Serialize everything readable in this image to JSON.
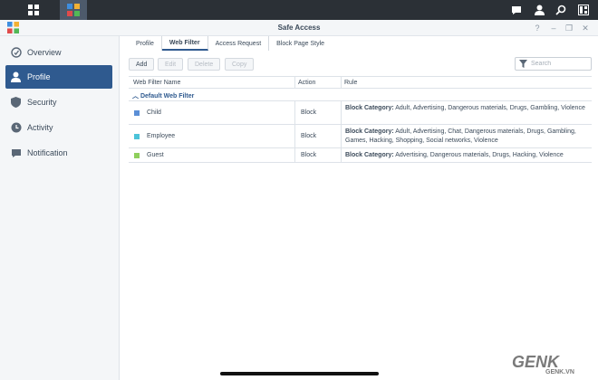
{
  "window": {
    "title": "Safe Access"
  },
  "sidebar": {
    "items": [
      {
        "label": "Overview",
        "icon": "overview-icon"
      },
      {
        "label": "Profile",
        "icon": "profile-icon",
        "active": true
      },
      {
        "label": "Security",
        "icon": "shield-icon"
      },
      {
        "label": "Activity",
        "icon": "activity-icon"
      },
      {
        "label": "Notification",
        "icon": "notification-icon"
      }
    ]
  },
  "tabs": [
    {
      "label": "Profile"
    },
    {
      "label": "Web Filter",
      "active": true
    },
    {
      "label": "Access Request"
    },
    {
      "label": "Block Page Style"
    }
  ],
  "toolbar": {
    "add": "Add",
    "edit": "Edit",
    "delete": "Delete",
    "copy": "Copy",
    "search_placeholder": "Search"
  },
  "grid": {
    "columns": {
      "name": "Web Filter Name",
      "action": "Action",
      "rule": "Rule"
    },
    "group": "Default Web Filter",
    "rows": [
      {
        "name": "Child",
        "color": "#5b8fd6",
        "action": "Block",
        "rule_label": "Block Category:",
        "rule_text": "Adult, Advertising, Dangerous materials, Drugs, Gambling, Violence"
      },
      {
        "name": "Employee",
        "color": "#4cc3d9",
        "action": "Block",
        "rule_label": "Block Category:",
        "rule_text": "Adult, Advertising, Chat, Dangerous materials, Drugs, Gambling, Games, Hacking, Shopping, Social networks, Violence"
      },
      {
        "name": "Guest",
        "color": "#8fcf5c",
        "action": "Block",
        "rule_label": "Block Category:",
        "rule_text": "Advertising, Dangerous materials, Drugs, Hacking, Violence"
      }
    ]
  },
  "watermark": {
    "logo": "GENK",
    "site": "GENK.VN"
  }
}
